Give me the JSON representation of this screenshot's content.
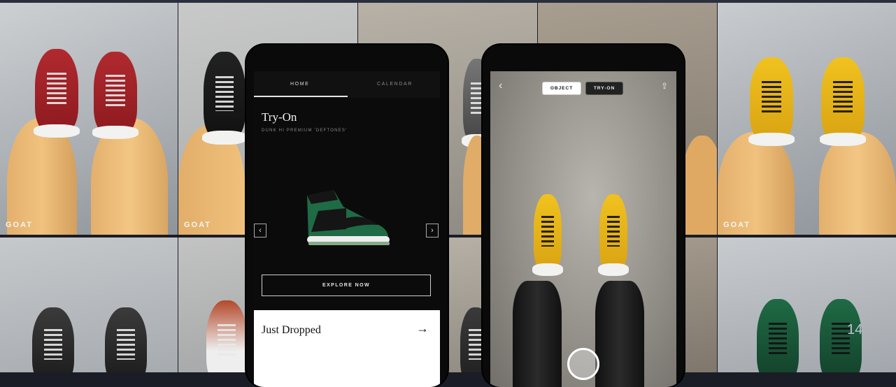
{
  "brand": {
    "watermark": "GOAT"
  },
  "home_phone": {
    "tabs": [
      {
        "label": "HOME"
      },
      {
        "label": "CALENDAR"
      }
    ],
    "title": "Try-On",
    "subtitle": "DUNK HI PREMIUM 'DEFTONES'",
    "prev_icon": "chevron-left-icon",
    "next_icon": "chevron-right-icon",
    "explore_label": "EXPLORE NOW",
    "just_dropped": {
      "label": "Just Dropped",
      "arrow": "→"
    }
  },
  "camera_phone": {
    "modes": [
      {
        "label": "OBJECT"
      },
      {
        "label": "TRY-ON"
      }
    ],
    "back_icon": "chevron-left-icon",
    "share_icon": "share-icon",
    "shutter_icon": "shutter-button"
  },
  "page_number": "14",
  "colors": {
    "phone_bg": "#0a0a0a",
    "tryon_green": "#1f6b45",
    "accent_yellow": "#e9b21a",
    "accent_red": "#9b1e22"
  }
}
